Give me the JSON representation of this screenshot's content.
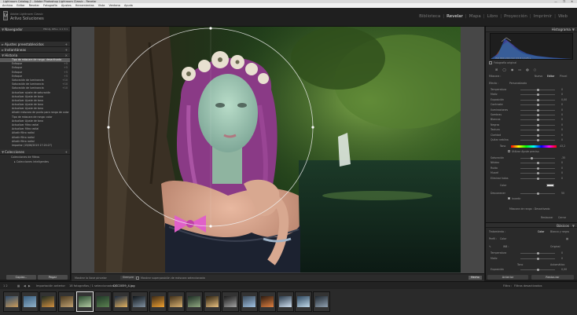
{
  "window": {
    "title": "Lightroom Catalog-2 - Adobe Photoshop Lightroom Classic - Revelar",
    "controls": "— ❐ ✕"
  },
  "menubar": [
    "Archivo",
    "Editar",
    "Revelar",
    "Fotografía",
    "Ajustes",
    "Herramientas",
    "Vista",
    "Ventana",
    "Ayuda"
  ],
  "identity": {
    "catalog": "Adobe Lightroom Classic",
    "name": "Arlivo Soluciones",
    "logo": "Lr"
  },
  "modules": {
    "items": [
      "Biblioteca",
      "Revelar",
      "Mapa",
      "Libro",
      "Proyección",
      "Imprimir",
      "Web"
    ],
    "active": "Revelar",
    "separator": "|"
  },
  "left_panel": {
    "navigator": {
      "label": "Navegador",
      "zoom": "ENCAJ. RELL. 1:1 3:1"
    },
    "presets": {
      "label": "Ajustes preestablecidos"
    },
    "snapshots": {
      "label": "Instantáneas"
    },
    "history": {
      "label": "Historia",
      "close": "×",
      "items": [
        {
          "text": "Tipo de máscara de rango: desactivada",
          "sel": true
        },
        {
          "text": "Enfoque",
          "v": "+5"
        },
        {
          "text": "Enfoque",
          "v": "+5"
        },
        {
          "text": "Enfoque",
          "v": "+5"
        },
        {
          "text": "Enfoque",
          "v": "+5"
        },
        {
          "text": "Saturación de luminancia",
          "v": "+10"
        },
        {
          "text": "Saturación de luminancia",
          "v": "+10"
        },
        {
          "text": "Saturación de luminancia",
          "v": "+10"
        },
        {
          "text": "Actualizar ajuste de saturación"
        },
        {
          "text": "Actualizar Ajuste de tono"
        },
        {
          "text": "Actualizar Ajuste de tono"
        },
        {
          "text": "Actualizar Ajuste de tono"
        },
        {
          "text": "Actualizar Ajuste de tono"
        },
        {
          "text": "Añadir máscara de punto para rango de color"
        },
        {
          "text": "Tipo de máscara de rango: color"
        },
        {
          "text": "Actualizar Ajuste de tono"
        },
        {
          "text": "Actualizar filtro radial"
        },
        {
          "text": "Actualizar filtro radial"
        },
        {
          "text": "Añadir filtro radial"
        },
        {
          "text": "Añadir filtro radial"
        },
        {
          "text": "Añadir filtro radial"
        },
        {
          "text": "Importar (15/06/2019 17:20:27)"
        }
      ]
    },
    "collections": {
      "label": "Colecciones",
      "sub": "Colecciones de filtros",
      "item": "Colecciones inteligentes"
    },
    "copy_button": "Copiar...",
    "paste_button": "Pegar"
  },
  "toolbar": {
    "before_after": "Mostrar la llave pincelar",
    "show": "Siempre",
    "overlay": "Mostrar superposición de máscara seleccionada",
    "done": "Hecho"
  },
  "right_panel": {
    "histogram_label": "Histograma",
    "histogram_values": "ISO 800   200 mm   f/2.8   1/125 s",
    "original_label": "Fotografía original",
    "mask_label": "Máscara :",
    "new": "Nuevo",
    "edit": "Editar",
    "brush": "Pincel",
    "effect": "Efecto :",
    "effect_value": "Personalizado",
    "sliders": [
      {
        "label": "Temperatura",
        "v": "0",
        "p": 0.5
      },
      {
        "label": "Matiz",
        "v": "0",
        "p": 0.5
      },
      {
        "label": "Exposición",
        "v": "0,00",
        "p": 0.5
      },
      {
        "label": "Contraste",
        "v": "0",
        "p": 0.5
      },
      {
        "label": "Iluminaciones",
        "v": "0",
        "p": 0.5
      },
      {
        "label": "Sombras",
        "v": "0",
        "p": 0.5
      },
      {
        "label": "Blancos",
        "v": "0",
        "p": 0.5
      },
      {
        "label": "Negros",
        "v": "0",
        "p": 0.5
      },
      {
        "label": "Textura",
        "v": "0",
        "p": 0.5
      },
      {
        "label": "Claridad",
        "v": "0",
        "p": 0.5
      },
      {
        "label": "Quitar neblina",
        "v": "0",
        "p": 0.5
      }
    ],
    "color": {
      "label": "Tono",
      "v": "43,2"
    },
    "color_opts": "Utilizar Ajuste preciso",
    "sliders2": [
      {
        "label": "Saturación",
        "v": "-35",
        "p": 0.32
      },
      {
        "label": "Nitidez",
        "v": "0",
        "p": 0.5
      },
      {
        "label": "Ruido",
        "v": "0",
        "p": 0.5
      },
      {
        "label": "Muaré",
        "v": "0",
        "p": 0.5
      },
      {
        "label": "Eliminar halos",
        "v": "0",
        "p": 0.5
      }
    ],
    "color_swatch": "Color",
    "feather": {
      "label": "Desvanecer",
      "v": "50",
      "p": 0.5
    },
    "invert": "Invertir",
    "range_mask": "Máscara de rango : Desactivado",
    "reset": "Restaurar",
    "close": "Cerrar",
    "basic_label": "Básicos",
    "treatment": "Tratamiento :",
    "color_tr": "Color",
    "bw_tr": "Blanco y negro",
    "profile": "Perfil :",
    "profile_val": "Color",
    "wb": "WB :",
    "wb_val": "Original",
    "temp": {
      "label": "Temperatura",
      "v": "0",
      "p": 0.5
    },
    "tint": {
      "label": "Matiz",
      "v": "0",
      "p": 0.5
    },
    "tone": "Tono",
    "auto": "Automático",
    "exposure": {
      "label": "Exposición",
      "v": "0,00",
      "p": 0.5
    },
    "contrast": {
      "label": "Contraste",
      "v": "0",
      "p": 0.5
    },
    "prev_button": "Anterior",
    "reset_button": "Restaurar"
  },
  "filmbar": {
    "left": "1   2",
    "source": "Importación anterior",
    "count": "18 fotografías / 1 seleccionadas /",
    "file": "DSC0059_4.jpg",
    "filter_label": "Filtro :",
    "filter_val": "Filtros desactivados"
  },
  "filmstrip": {
    "thumbs": [
      {
        "c1": "#2d4a6b",
        "c2": "#c89a5a"
      },
      {
        "c1": "#3a5f80",
        "c2": "#8fb0c8"
      },
      {
        "c1": "#1e2a20",
        "c2": "#d09040"
      },
      {
        "c1": "#4a3a20",
        "c2": "#c0a070"
      },
      {
        "c1": "#2a4a30",
        "c2": "#b0c8a0"
      },
      {
        "c1": "#203828",
        "c2": "#5a8050"
      },
      {
        "c1": "#1a2a40",
        "c2": "#e0b060"
      },
      {
        "c1": "#0e1418",
        "c2": "#8090a0"
      },
      {
        "c1": "#3a2a18",
        "c2": "#f0a030"
      },
      {
        "c1": "#40301a",
        "c2": "#d8b070"
      },
      {
        "c1": "#1c2c24",
        "c2": "#90a880"
      },
      {
        "c1": "#2a2010",
        "c2": "#e8c080"
      },
      {
        "c1": "#1a1a1a",
        "c2": "#a0a0a0"
      },
      {
        "c1": "#3a4a5a",
        "c2": "#a0c0e0"
      },
      {
        "c1": "#2a1a10",
        "c2": "#e08040"
      },
      {
        "c1": "#2a3a4a",
        "c2": "#d0e0f0"
      },
      {
        "c1": "#2e4860",
        "c2": "#c0d8e8"
      },
      {
        "c1": "#202830",
        "c2": "#90a0b0"
      }
    ],
    "active_index": 4
  }
}
